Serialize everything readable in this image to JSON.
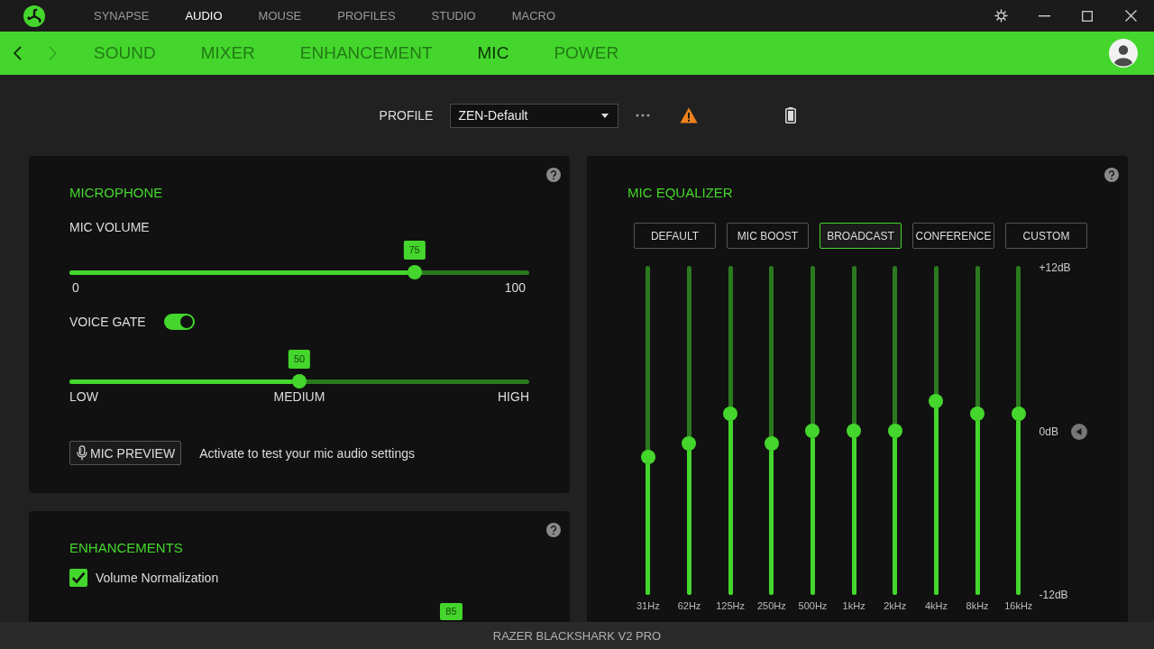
{
  "title_bar": {
    "tabs": [
      {
        "label": "SYNAPSE",
        "selected": false
      },
      {
        "label": "AUDIO",
        "selected": true
      },
      {
        "label": "MOUSE",
        "selected": false
      },
      {
        "label": "PROFILES",
        "selected": false
      },
      {
        "label": "STUDIO",
        "selected": false
      },
      {
        "label": "MACRO",
        "selected": false
      }
    ]
  },
  "sub_nav": {
    "history": [
      {
        "kind": "back",
        "disabled": false
      },
      {
        "kind": "forward",
        "disabled": true
      }
    ],
    "tabs": [
      {
        "label": "SOUND",
        "selected": false
      },
      {
        "label": "MIXER",
        "selected": false
      },
      {
        "label": "ENHANCEMENT",
        "selected": false
      },
      {
        "label": "MIC",
        "selected": true
      },
      {
        "label": "POWER",
        "selected": false
      }
    ]
  },
  "profile_bar": {
    "label": "PROFILE",
    "profile": "ZEN-Default"
  },
  "microphone": {
    "title": "MICROPHONE",
    "volume": {
      "label": "MIC VOLUME",
      "level": 0.75,
      "reading": "75",
      "scale": [
        "0",
        "100"
      ]
    },
    "voice_gate": {
      "label": "VOICE GATE",
      "on": true,
      "level": 0.5,
      "reading": "50",
      "scale": [
        "LOW",
        "MEDIUM",
        "HIGH"
      ]
    },
    "preview": {
      "button": "MIC PREVIEW",
      "hint": "Activate to test your mic audio settings"
    }
  },
  "enhancements": {
    "title": "ENHANCEMENTS",
    "options": [
      {
        "label": "Volume Normalization",
        "checked": true
      }
    ],
    "slider": {
      "level": 0.83,
      "reading": "85"
    }
  },
  "equalizer": {
    "title": "MIC EQUALIZER",
    "presets": [
      {
        "label": "DEFAULT",
        "selected": false
      },
      {
        "label": "MIC BOOST",
        "selected": false
      },
      {
        "label": "BROADCAST",
        "selected": true
      },
      {
        "label": "CONFERENCE",
        "selected": false
      },
      {
        "label": "CUSTOM",
        "selected": false
      }
    ],
    "scale": [
      "+12dB",
      "0dB",
      "-12dB"
    ],
    "bands": [
      {
        "label": "31Hz",
        "level": 0.42
      },
      {
        "label": "62Hz",
        "level": 0.46
      },
      {
        "label": "125Hz",
        "level": 0.55
      },
      {
        "label": "250Hz",
        "level": 0.46
      },
      {
        "label": "500Hz",
        "level": 0.5
      },
      {
        "label": "1kHz",
        "level": 0.5
      },
      {
        "label": "2kHz",
        "level": 0.5
      },
      {
        "label": "4kHz",
        "level": 0.59
      },
      {
        "label": "8kHz",
        "level": 0.55
      },
      {
        "label": "16kHz",
        "level": 0.55
      }
    ]
  },
  "status_bar": {
    "device": "RAZER BLACKSHARK V2 PRO"
  }
}
